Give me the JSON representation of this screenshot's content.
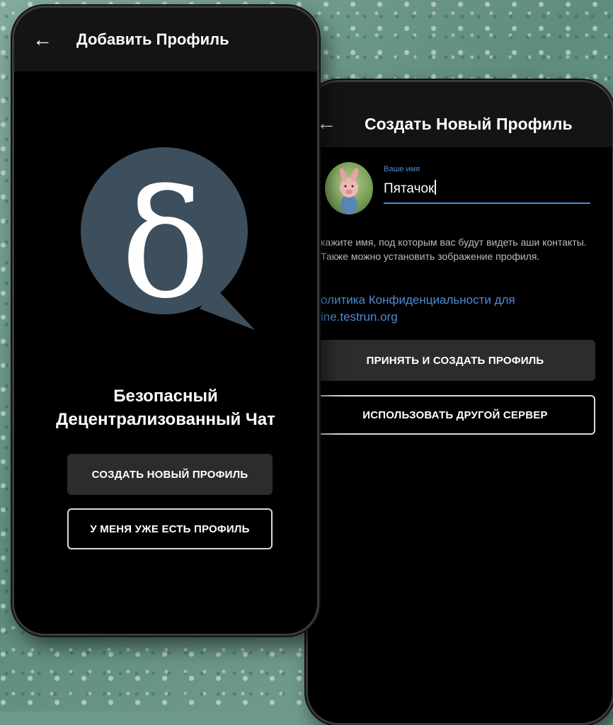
{
  "front": {
    "appbar": {
      "back_icon": "arrow-left-icon",
      "title": "Добавить Профиль"
    },
    "logo": {
      "glyph": "δ",
      "bubble_color": "#3d4f5c"
    },
    "headline": [
      "Безопасный",
      "Децентрализованный Чат"
    ],
    "buttons": {
      "create": "СОЗДАТЬ НОВЫЙ ПРОФИЛЬ",
      "existing": "У МЕНЯ УЖЕ ЕСТЬ ПРОФИЛЬ"
    }
  },
  "back": {
    "appbar": {
      "back_icon": "arrow-left-icon",
      "title": "Создать Новый Профиль"
    },
    "avatar": {
      "icon": "piglet-avatar-icon"
    },
    "name_field": {
      "label": "Ваше имя",
      "value": "Пятачок"
    },
    "help_text": "кажите имя, под которым вас будут видеть аши контакты. Также можно установить зображение профиля.",
    "privacy_link": "олитика Конфиденциальности для ine.testrun.org",
    "buttons": {
      "accept": "ПРИНЯТЬ И СОЗДАТЬ ПРОФИЛЬ",
      "other_server": "ИСПОЛЬЗОВАТЬ ДРУГОЙ СЕРВЕР"
    }
  },
  "colors": {
    "accent": "#4d8bd6",
    "button_fill": "#2c2c2c",
    "background": "#6f9a8c"
  }
}
